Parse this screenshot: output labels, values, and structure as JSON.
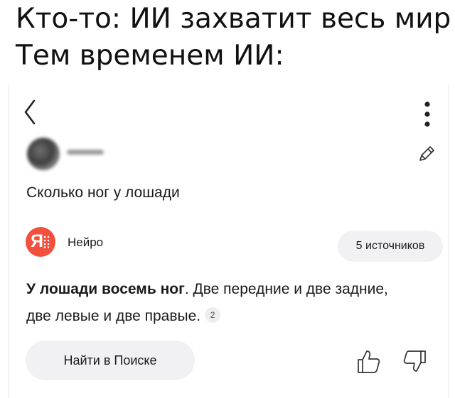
{
  "meme": {
    "caption_line_1": "Кто-то: ИИ захватит весь мир",
    "caption_line_2": "Тем временем ИИ:"
  },
  "header": {
    "back_icon": "chevron-left-icon",
    "more_icon": "more-vertical-icon"
  },
  "post": {
    "author_avatar": "blurred-avatar",
    "edit_icon": "pencil-icon",
    "question": "Сколько ног у лошади"
  },
  "neuro": {
    "logo_letter": "Я",
    "name": "Нейро",
    "sources_label": "5 источников",
    "brand_color": "#f2503c"
  },
  "answer": {
    "bold_part": "У лошади восемь ног",
    "rest_line_1": ". Две передние и две задние,",
    "line_2": "две левые и две правые.",
    "citation": "2"
  },
  "actions": {
    "search_label": "Найти в Поиске",
    "like_icon": "thumbs-up-icon",
    "dislike_icon": "thumbs-down-icon"
  }
}
